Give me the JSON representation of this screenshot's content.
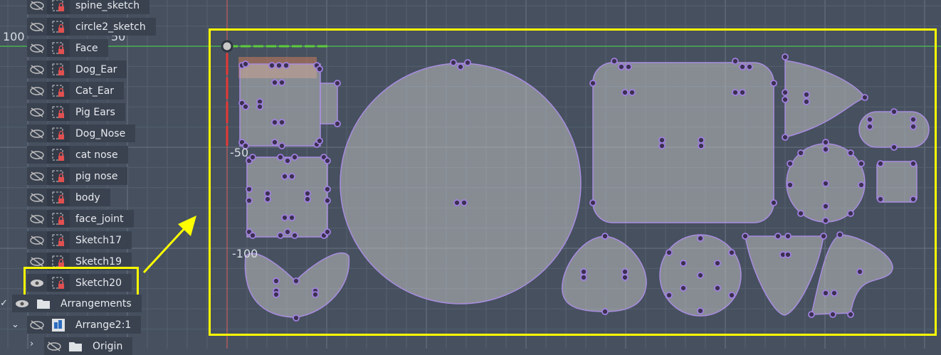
{
  "browser": {
    "items": [
      {
        "label": "spine_sketch",
        "visible": false
      },
      {
        "label": "circle2_sketch",
        "visible": false
      },
      {
        "label": "Face",
        "visible": false
      },
      {
        "label": "Dog_Ear",
        "visible": false
      },
      {
        "label": "Cat_Ear",
        "visible": false
      },
      {
        "label": "Pig Ears",
        "visible": false
      },
      {
        "label": "Dog_Nose",
        "visible": false
      },
      {
        "label": "cat nose",
        "visible": false
      },
      {
        "label": "pig nose",
        "visible": false
      },
      {
        "label": "body",
        "visible": false
      },
      {
        "label": "face_joint",
        "visible": false
      },
      {
        "label": "Sketch17",
        "visible": false
      },
      {
        "label": "Sketch19",
        "visible": false
      },
      {
        "label": "Sketch20",
        "visible": true,
        "highlighted": true
      }
    ],
    "folder": {
      "label": "Arrangements"
    },
    "arrange": {
      "label": "Arrange2:1"
    },
    "origin": {
      "label": "Origin"
    }
  },
  "canvas": {
    "axis_labels": [
      "100",
      "50",
      "-50",
      "-100"
    ],
    "colors": {
      "highlight": "#ffff00",
      "sketch_stroke": "#a98de0",
      "x_axis": "#4caf50",
      "y_axis": "#e53935"
    }
  }
}
